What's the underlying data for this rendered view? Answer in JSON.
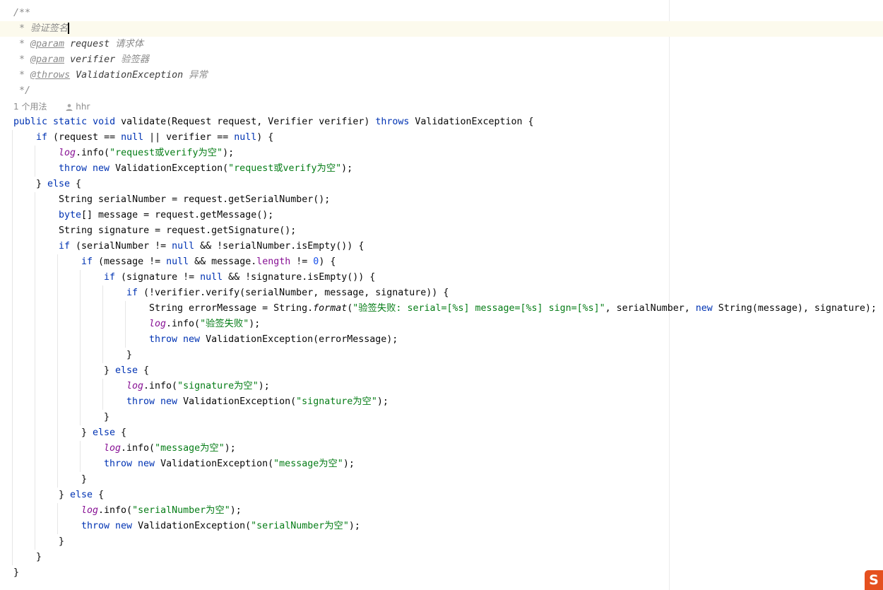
{
  "editor": {
    "language": "java",
    "current_line": 1,
    "code_lines": [
      {
        "indent": 0,
        "tokens": [
          {
            "t": "/**",
            "c": "doc"
          }
        ]
      },
      {
        "indent": 0,
        "tokens": [
          {
            "t": " * 验证签名",
            "c": "doc"
          }
        ],
        "caret": true
      },
      {
        "indent": 0,
        "tokens": [
          {
            "t": " * ",
            "c": "doc"
          },
          {
            "t": "@param",
            "c": "doctag"
          },
          {
            "t": " request",
            "c": "docref"
          },
          {
            "t": " 请求体",
            "c": "doc"
          }
        ]
      },
      {
        "indent": 0,
        "tokens": [
          {
            "t": " * ",
            "c": "doc"
          },
          {
            "t": "@param",
            "c": "doctag"
          },
          {
            "t": " verifier",
            "c": "docref"
          },
          {
            "t": " 验签器",
            "c": "doc"
          }
        ]
      },
      {
        "indent": 0,
        "tokens": [
          {
            "t": " * ",
            "c": "doc"
          },
          {
            "t": "@throws",
            "c": "doctag"
          },
          {
            "t": " ValidationException",
            "c": "docref"
          },
          {
            "t": " 异常",
            "c": "doc"
          }
        ]
      },
      {
        "indent": 0,
        "tokens": [
          {
            "t": " */",
            "c": "doc"
          }
        ]
      },
      {
        "hint": true
      },
      {
        "indent": 0,
        "tokens": [
          {
            "t": "public static void ",
            "c": "kw"
          },
          {
            "t": "validate(Request request, Verifier verifier) ",
            "c": "def"
          },
          {
            "t": "throws ",
            "c": "kw"
          },
          {
            "t": "ValidationException {",
            "c": "def"
          }
        ]
      },
      {
        "indent": 1,
        "tokens": [
          {
            "t": "if ",
            "c": "kw"
          },
          {
            "t": "(request == ",
            "c": "def"
          },
          {
            "t": "null",
            "c": "kw"
          },
          {
            "t": " || verifier == ",
            "c": "def"
          },
          {
            "t": "null",
            "c": "kw"
          },
          {
            "t": ") {",
            "c": "def"
          }
        ]
      },
      {
        "indent": 2,
        "tokens": [
          {
            "t": "log",
            "c": "logf"
          },
          {
            "t": ".info(",
            "c": "def"
          },
          {
            "t": "\"request或verify为空\"",
            "c": "str"
          },
          {
            "t": ");",
            "c": "def"
          }
        ]
      },
      {
        "indent": 2,
        "tokens": [
          {
            "t": "throw new ",
            "c": "kw"
          },
          {
            "t": "ValidationException(",
            "c": "def"
          },
          {
            "t": "\"request或verify为空\"",
            "c": "str"
          },
          {
            "t": ");",
            "c": "def"
          }
        ]
      },
      {
        "indent": 1,
        "tokens": [
          {
            "t": "} ",
            "c": "def"
          },
          {
            "t": "else",
            "c": "kw"
          },
          {
            "t": " {",
            "c": "def"
          }
        ]
      },
      {
        "indent": 2,
        "tokens": [
          {
            "t": "String serialNumber = request.getSerialNumber();",
            "c": "def"
          }
        ]
      },
      {
        "indent": 2,
        "tokens": [
          {
            "t": "byte",
            "c": "kw"
          },
          {
            "t": "[] message = request.getMessage();",
            "c": "def"
          }
        ]
      },
      {
        "indent": 2,
        "tokens": [
          {
            "t": "String signature = request.getSignature();",
            "c": "def"
          }
        ]
      },
      {
        "indent": 2,
        "tokens": [
          {
            "t": "if ",
            "c": "kw"
          },
          {
            "t": "(serialNumber != ",
            "c": "def"
          },
          {
            "t": "null",
            "c": "kw"
          },
          {
            "t": " && !serialNumber.isEmpty()) {",
            "c": "def"
          }
        ]
      },
      {
        "indent": 3,
        "tokens": [
          {
            "t": "if ",
            "c": "kw"
          },
          {
            "t": "(message != ",
            "c": "def"
          },
          {
            "t": "null",
            "c": "kw"
          },
          {
            "t": " && message.",
            "c": "def"
          },
          {
            "t": "length",
            "c": "fld"
          },
          {
            "t": " != ",
            "c": "def"
          },
          {
            "t": "0",
            "c": "num"
          },
          {
            "t": ") {",
            "c": "def"
          }
        ]
      },
      {
        "indent": 4,
        "tokens": [
          {
            "t": "if ",
            "c": "kw"
          },
          {
            "t": "(signature != ",
            "c": "def"
          },
          {
            "t": "null",
            "c": "kw"
          },
          {
            "t": " && !signature.isEmpty()) {",
            "c": "def"
          }
        ]
      },
      {
        "indent": 5,
        "tokens": [
          {
            "t": "if ",
            "c": "kw"
          },
          {
            "t": "(!verifier.verify(serialNumber, message, signature)) {",
            "c": "def"
          }
        ]
      },
      {
        "indent": 6,
        "tokens": [
          {
            "t": "String errorMessage = String.",
            "c": "def"
          },
          {
            "t": "format",
            "c": "sfn"
          },
          {
            "t": "(",
            "c": "def"
          },
          {
            "t": "\"验签失败: serial=[%s] message=[%s] sign=[%s]\"",
            "c": "str"
          },
          {
            "t": ", serialNumber, ",
            "c": "def"
          },
          {
            "t": "new ",
            "c": "kw"
          },
          {
            "t": "String(message), signature);",
            "c": "def"
          }
        ]
      },
      {
        "indent": 6,
        "tokens": [
          {
            "t": "log",
            "c": "logf"
          },
          {
            "t": ".info(",
            "c": "def"
          },
          {
            "t": "\"验签失败\"",
            "c": "str"
          },
          {
            "t": ");",
            "c": "def"
          }
        ]
      },
      {
        "indent": 6,
        "tokens": [
          {
            "t": "throw new ",
            "c": "kw"
          },
          {
            "t": "ValidationException(errorMessage);",
            "c": "def"
          }
        ]
      },
      {
        "indent": 5,
        "tokens": [
          {
            "t": "}",
            "c": "def"
          }
        ]
      },
      {
        "indent": 4,
        "tokens": [
          {
            "t": "} ",
            "c": "def"
          },
          {
            "t": "else",
            "c": "kw"
          },
          {
            "t": " {",
            "c": "def"
          }
        ]
      },
      {
        "indent": 5,
        "tokens": [
          {
            "t": "log",
            "c": "logf"
          },
          {
            "t": ".info(",
            "c": "def"
          },
          {
            "t": "\"signature为空\"",
            "c": "str"
          },
          {
            "t": ");",
            "c": "def"
          }
        ]
      },
      {
        "indent": 5,
        "tokens": [
          {
            "t": "throw new ",
            "c": "kw"
          },
          {
            "t": "ValidationException(",
            "c": "def"
          },
          {
            "t": "\"signature为空\"",
            "c": "str"
          },
          {
            "t": ");",
            "c": "def"
          }
        ]
      },
      {
        "indent": 4,
        "tokens": [
          {
            "t": "}",
            "c": "def"
          }
        ]
      },
      {
        "indent": 3,
        "tokens": [
          {
            "t": "} ",
            "c": "def"
          },
          {
            "t": "else",
            "c": "kw"
          },
          {
            "t": " {",
            "c": "def"
          }
        ]
      },
      {
        "indent": 4,
        "tokens": [
          {
            "t": "log",
            "c": "logf"
          },
          {
            "t": ".info(",
            "c": "def"
          },
          {
            "t": "\"message为空\"",
            "c": "str"
          },
          {
            "t": ");",
            "c": "def"
          }
        ]
      },
      {
        "indent": 4,
        "tokens": [
          {
            "t": "throw new ",
            "c": "kw"
          },
          {
            "t": "ValidationException(",
            "c": "def"
          },
          {
            "t": "\"message为空\"",
            "c": "str"
          },
          {
            "t": ");",
            "c": "def"
          }
        ]
      },
      {
        "indent": 3,
        "tokens": [
          {
            "t": "}",
            "c": "def"
          }
        ]
      },
      {
        "indent": 2,
        "tokens": [
          {
            "t": "} ",
            "c": "def"
          },
          {
            "t": "else",
            "c": "kw"
          },
          {
            "t": " {",
            "c": "def"
          }
        ]
      },
      {
        "indent": 3,
        "tokens": [
          {
            "t": "log",
            "c": "logf"
          },
          {
            "t": ".info(",
            "c": "def"
          },
          {
            "t": "\"serialNumber为空\"",
            "c": "str"
          },
          {
            "t": ");",
            "c": "def"
          }
        ]
      },
      {
        "indent": 3,
        "tokens": [
          {
            "t": "throw new ",
            "c": "kw"
          },
          {
            "t": "ValidationException(",
            "c": "def"
          },
          {
            "t": "\"serialNumber为空\"",
            "c": "str"
          },
          {
            "t": ");",
            "c": "def"
          }
        ]
      },
      {
        "indent": 2,
        "tokens": [
          {
            "t": "}",
            "c": "def"
          }
        ]
      },
      {
        "indent": 1,
        "tokens": [
          {
            "t": "}",
            "c": "def"
          }
        ]
      },
      {
        "indent": 0,
        "tokens": [
          {
            "t": "}",
            "c": "def"
          }
        ]
      }
    ]
  },
  "inlay_hint": {
    "usages": "1 个用法",
    "author": "hhr"
  },
  "brand_logo": {
    "text": "S"
  },
  "colors": {
    "keyword": "#0033b3",
    "string": "#067d17",
    "number": "#1750eb",
    "field": "#871094",
    "comment": "#8c8c8c",
    "current_line": "#fcfaed",
    "brand": "#e5501f"
  }
}
